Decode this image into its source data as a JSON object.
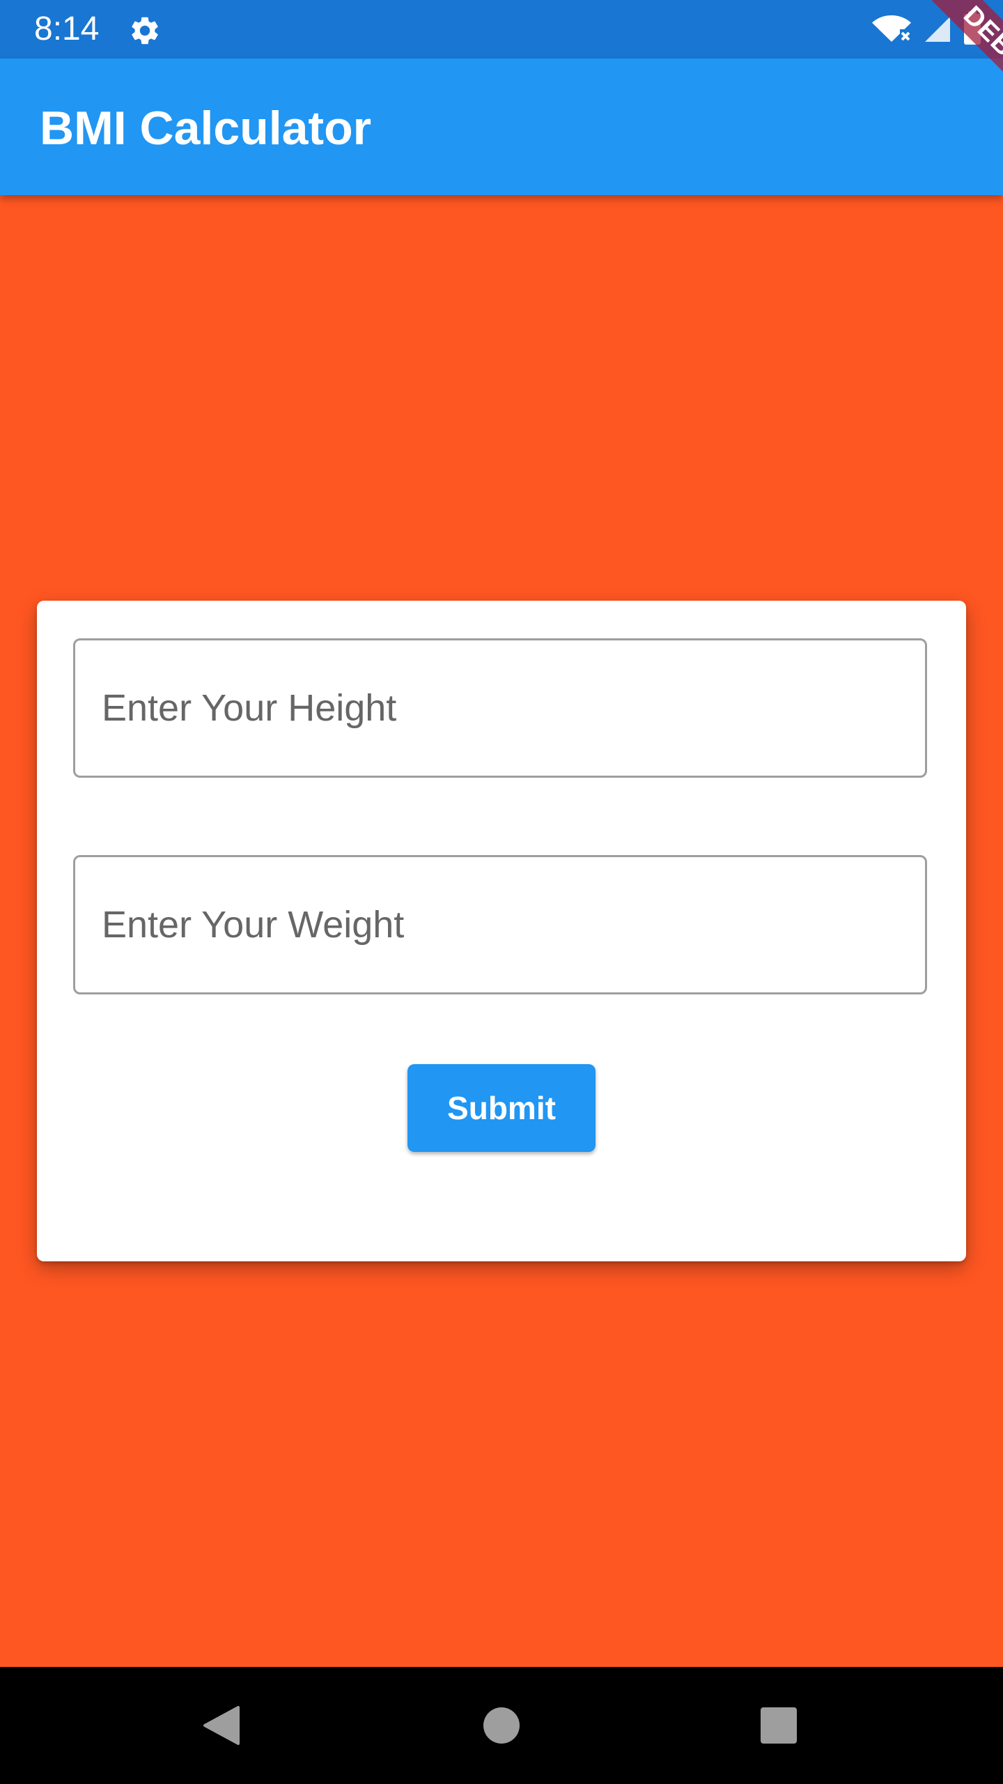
{
  "status_bar": {
    "time": "8:14",
    "icons": [
      "gear-icon",
      "wifi-off-icon",
      "signal-icon",
      "battery-icon"
    ]
  },
  "app_bar": {
    "title": "BMI Calculator",
    "debug_banner": "DEBUG"
  },
  "form": {
    "height_field": {
      "placeholder": "Enter Your Height",
      "value": ""
    },
    "weight_field": {
      "placeholder": "Enter Your Weight",
      "value": ""
    },
    "submit_label": "Submit"
  },
  "nav_bar": {
    "icons": [
      "back-icon",
      "home-icon",
      "recents-icon"
    ]
  },
  "colors": {
    "status_bar": "#1976D2",
    "app_bar": "#2196F3",
    "background": "#FF5722",
    "card": "#FFFFFF",
    "button": "#2196F3",
    "nav_bar": "#000000"
  }
}
